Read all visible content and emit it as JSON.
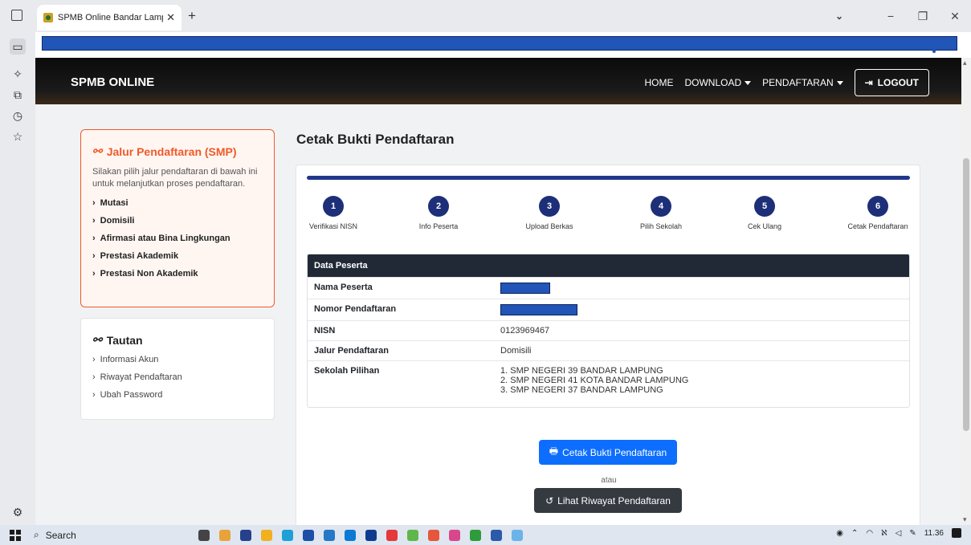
{
  "browser": {
    "tab_title": "SPMB Online Bandar Lampung",
    "tab_close": "✕",
    "new_tab": "+",
    "window_buttons": {
      "dropdown": "⌄",
      "minimize": "−",
      "restore": "❐",
      "close": "✕"
    }
  },
  "navbar": {
    "brand": "SPMB ONLINE",
    "home": "HOME",
    "download": "DOWNLOAD",
    "pendaftaran": "PENDAFTARAN",
    "logout": "LOGOUT"
  },
  "jalur": {
    "title": "Jalur Pendaftaran (SMP)",
    "description": "Silakan pilih jalur pendaftaran di bawah ini untuk melanjutkan proses pendaftaran.",
    "items": [
      "Mutasi",
      "Domisili",
      "Afirmasi atau Bina Lingkungan",
      "Prestasi Akademik",
      "Prestasi Non Akademik"
    ]
  },
  "tautan": {
    "title": "Tautan",
    "items": [
      "Informasi Akun",
      "Riwayat Pendaftaran",
      "Ubah Password"
    ]
  },
  "main": {
    "title": "Cetak Bukti Pendaftaran",
    "steps": [
      {
        "num": "1",
        "label": "Verifikasi NISN"
      },
      {
        "num": "2",
        "label": "Info Peserta"
      },
      {
        "num": "3",
        "label": "Upload Berkas"
      },
      {
        "num": "4",
        "label": "Pilih Sekolah"
      },
      {
        "num": "5",
        "label": "Cek Ulang"
      },
      {
        "num": "6",
        "label": "Cetak Pendaftaran"
      }
    ],
    "table": {
      "header": "Data Peserta",
      "rows": [
        {
          "key": "Nama Peserta",
          "value": ""
        },
        {
          "key": "Nomor Pendaftaran",
          "value": ""
        },
        {
          "key": "NISN",
          "value": "0123969467"
        },
        {
          "key": "Jalur Pendaftaran",
          "value": "Domisili"
        },
        {
          "key": "Sekolah Pilihan",
          "value": ""
        }
      ],
      "sekolah": [
        "1. SMP NEGERI 39 BANDAR LAMPUNG",
        "2. SMP NEGERI 41 KOTA BANDAR LAMPUNG",
        "3. SMP NEGERI 37 BANDAR LAMPUNG"
      ]
    },
    "print_button": "Cetak Bukti Pendaftaran",
    "atau": "atau",
    "riwayat_button": "Lihat Riwayat Pendaftaran"
  },
  "taskbar": {
    "search": "Search",
    "time": "11.36"
  },
  "colors": {
    "accent_orange": "#f05a28",
    "step_blue": "#1d2f78",
    "primary_button": "#0d6efd",
    "dark_button": "#343a40",
    "table_header": "#212936"
  },
  "icons": [
    "link-icon",
    "chevron-right-icon",
    "printer-icon",
    "history-icon",
    "logout-icon",
    "caret-down-icon",
    "search-icon",
    "gear-icon"
  ]
}
